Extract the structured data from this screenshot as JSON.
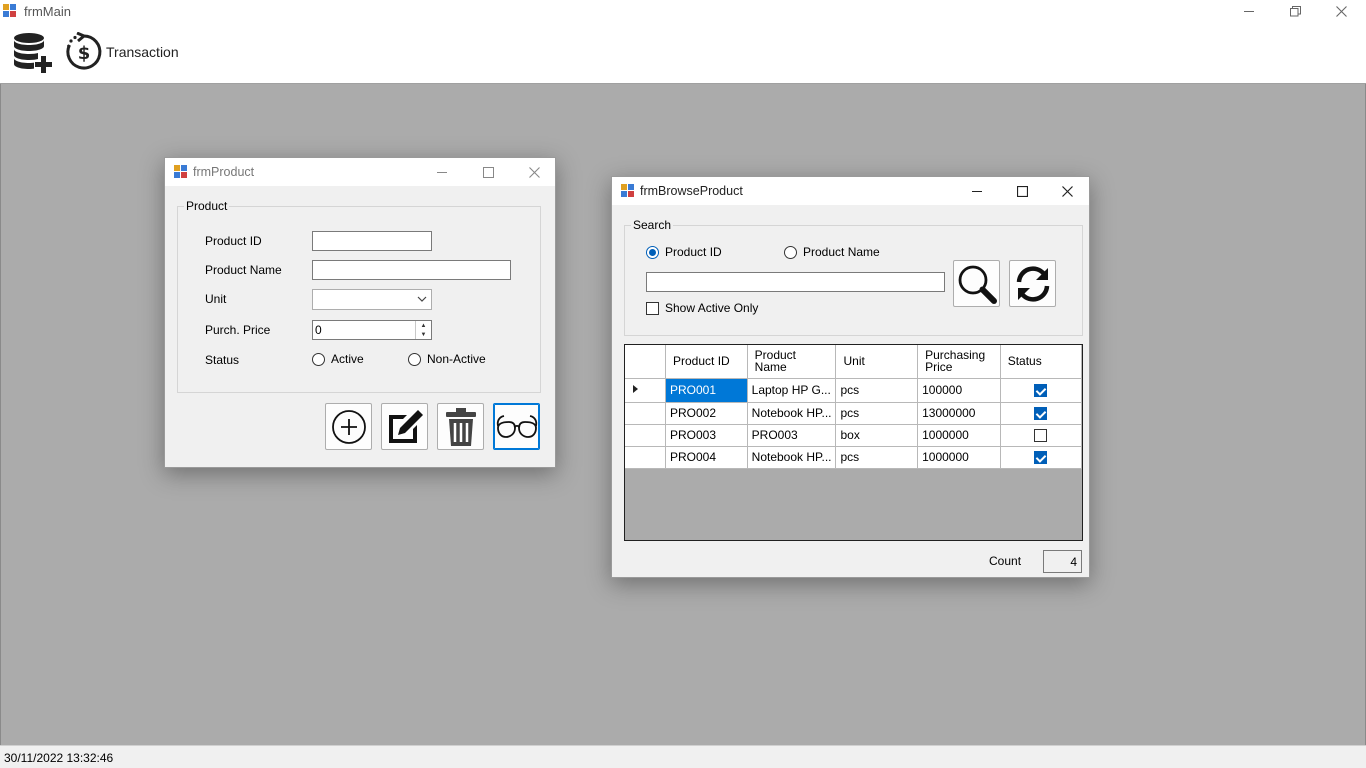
{
  "main_window": {
    "title": "frmMain",
    "toolbar": {
      "transaction_label": "Transaction"
    },
    "status_datetime": "30/11/2022 13:32:46"
  },
  "product_form": {
    "title": "frmProduct",
    "group_label": "Product",
    "fields": {
      "product_id_label": "Product ID",
      "product_id_value": "",
      "product_name_label": "Product Name",
      "product_name_value": "",
      "unit_label": "Unit",
      "unit_value": "",
      "purch_price_label": "Purch. Price",
      "purch_price_value": "0",
      "status_label": "Status",
      "status_active": "Active",
      "status_non_active": "Non-Active"
    },
    "buttons": [
      "add-icon",
      "edit-icon",
      "trash-icon",
      "glasses-icon"
    ]
  },
  "browse_form": {
    "title": "frmBrowseProduct",
    "search_group_label": "Search",
    "radio_product_id": "Product ID",
    "radio_product_name": "Product Name",
    "selected_radio": "Product ID",
    "search_value": "",
    "show_active_only_label": "Show Active Only",
    "show_active_only_checked": false,
    "columns": [
      "Product ID",
      "Product Name",
      "Unit",
      "Purchasing Price",
      "Status"
    ],
    "rows": [
      {
        "product_id": "PRO001",
        "product_name": "Laptop HP G...",
        "unit": "pcs",
        "purchasing_price": "100000",
        "status": true
      },
      {
        "product_id": "PRO002",
        "product_name": "Notebook HP...",
        "unit": "pcs",
        "purchasing_price": "13000000",
        "status": true
      },
      {
        "product_id": "PRO003",
        "product_name": "PRO003",
        "unit": "box",
        "purchasing_price": "1000000",
        "status": false
      },
      {
        "product_id": "PRO004",
        "product_name": "Notebook HP...",
        "unit": "pcs",
        "purchasing_price": "1000000",
        "status": true
      }
    ],
    "count_label": "Count",
    "count_value": "4"
  },
  "colors": {
    "mdi_background": "#ababab",
    "selection": "#0078d7",
    "check_accent": "#005fb8"
  }
}
